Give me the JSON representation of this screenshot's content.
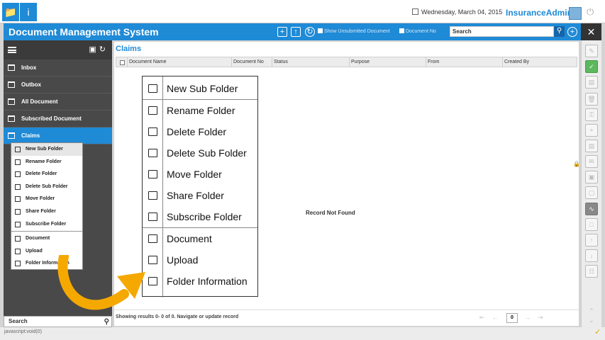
{
  "header": {
    "date": "Wednesday, March 04, 2015",
    "username": "InsuranceAdmin"
  },
  "appbar": {
    "title": "Document Management System",
    "check_show_unsubmitted": "Show Unsubmitted Document",
    "check_document_no": "Document No",
    "search_placeholder": "Search"
  },
  "sidebar": {
    "items": [
      {
        "label": "Inbox"
      },
      {
        "label": "Outbox"
      },
      {
        "label": "All Document"
      },
      {
        "label": "Subscribed Document"
      },
      {
        "label": "Claims"
      }
    ],
    "search_placeholder": "Search"
  },
  "context_menu": {
    "items": [
      {
        "label": "New Sub Folder",
        "icon": "folder-icon"
      },
      {
        "label": "Rename Folder",
        "icon": "rename-folder-icon"
      },
      {
        "label": "Delete Folder",
        "icon": "delete-folder-icon"
      },
      {
        "label": "Delete Sub Folder",
        "icon": "delete-subfolder-icon"
      },
      {
        "label": "Move Folder",
        "icon": "move-folder-icon"
      },
      {
        "label": "Share Folder",
        "icon": "share-folder-icon"
      },
      {
        "label": "Subscribe Folder",
        "icon": "subscribe-folder-icon"
      },
      {
        "label": "Document",
        "icon": "document-icon"
      },
      {
        "label": "Upload",
        "icon": "upload-icon"
      },
      {
        "label": "Folder Information",
        "icon": "info-icon"
      }
    ]
  },
  "main": {
    "breadcrumb": "Claims",
    "columns": [
      "Document Name",
      "Document No",
      "Status",
      "Purpose",
      "From",
      "Created By"
    ],
    "empty_text": "Record Not Found",
    "footer_text": "Showing results 0- 0 of 0. Navigate or update record",
    "page_value": "0"
  },
  "statusbar": {
    "text": "javascript:void(0)"
  },
  "colors": {
    "accent": "#1f8ad6",
    "sidebar": "#494949",
    "arrow": "#f5a800"
  }
}
